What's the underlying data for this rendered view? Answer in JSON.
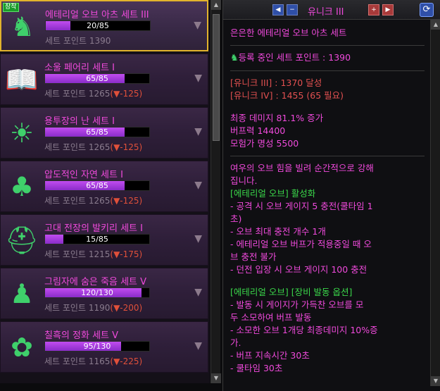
{
  "sets": [
    {
      "name": "에테리얼 오브 아츠 세트 III",
      "progress": "20/85",
      "fill": 0.235,
      "points_label": "세트 포인트",
      "points": "1390",
      "delta": "",
      "selected": true,
      "icon": "fox-mask-icon",
      "color": "#3fd06b"
    },
    {
      "name": "소울 페어리 세트 I",
      "progress": "65/85",
      "fill": 0.765,
      "points_label": "세트 포인트",
      "points": "1265",
      "delta": "(▼-125)",
      "selected": false,
      "icon": "book-icon",
      "color": "#3fd06b"
    },
    {
      "name": "용투장의 난 세트 I",
      "progress": "65/85",
      "fill": 0.765,
      "points_label": "세트 포인트",
      "points": "1265",
      "delta": "(▼-125)",
      "selected": false,
      "icon": "sunrise-icon",
      "color": "#3fd06b"
    },
    {
      "name": "압도적인 자연 세트 I",
      "progress": "65/85",
      "fill": 0.765,
      "points_label": "세트 포인트",
      "points": "1265",
      "delta": "(▼-125)",
      "selected": false,
      "icon": "tree-icon",
      "color": "#3fd06b"
    },
    {
      "name": "고대 전장의 발키리 세트 I",
      "progress": "15/85",
      "fill": 0.176,
      "points_label": "세트 포인트",
      "points": "1215",
      "delta": "(▼-175)",
      "selected": false,
      "icon": "helmet-icon",
      "color": "#3fd06b"
    },
    {
      "name": "그림자에 숨은 죽음 세트 V",
      "progress": "120/130",
      "fill": 0.923,
      "points_label": "세트 포인트",
      "points": "1190",
      "delta": "(▼-200)",
      "selected": false,
      "icon": "shadow-figure-icon",
      "color": "#3fd06b"
    },
    {
      "name": "칠흑의 정화 세트 V",
      "progress": "95/130",
      "fill": 0.73,
      "points_label": "세트 포인트",
      "points": "1165",
      "delta": "(▼-225)",
      "selected": false,
      "icon": "rose-icon",
      "color": "#3fd06b"
    }
  ],
  "equip_badge": "장착",
  "header": {
    "tier_title": "유니크 III",
    "prev_label": "◀",
    "next_label": "▶",
    "minus_label": "−",
    "plus_label": "+"
  },
  "detail": {
    "set_title": "은은한 에테리얼 오브 아츠 세트",
    "registered_points": "등록 중인 세트 포인트 : 1390",
    "tier3": "[유니크 III] : 1370 달성",
    "tier4": "[유니크 IV] : 1455 (65 필요)",
    "stat1": "최종 데미지 81.1% 증가",
    "stat2": "버프력 14400",
    "stat3": "모험가 명성 5500",
    "desc1": "여우의 오브 힘을 빌려 순간적으로 강해",
    "desc2": "집니다.",
    "desc3": "[에테리얼 오브] 활성화",
    "desc4": "- 공격 시 오브 게이지 5 충전(쿨타임 1",
    "desc5": "초)",
    "desc6": "- 오브 최대 충전 개수 1개",
    "desc7": "- 에테리얼 오브 버프가 적용중일 때 오",
    "desc8": "브 충전 불가",
    "desc9": "- 던전 입장 시 오브 게이지 100 충전",
    "desc10": "[에테리얼 오브] [장비 발동 옵션]",
    "desc11": "- 발동 시 게이지가 가득찬 오브를 모",
    "desc12": "두 소모하여 버프 발동",
    "desc13": "- 소모한 오브 1개당 최종데미지 10%증",
    "desc14": "가.",
    "desc15": "- 버프 지속시간 30초",
    "desc16": "- 쿨타임 30초"
  },
  "colors": {
    "accent": "#f04adc",
    "gold": "#e2b32c",
    "red": "#e25050",
    "green": "#3ad64a"
  }
}
